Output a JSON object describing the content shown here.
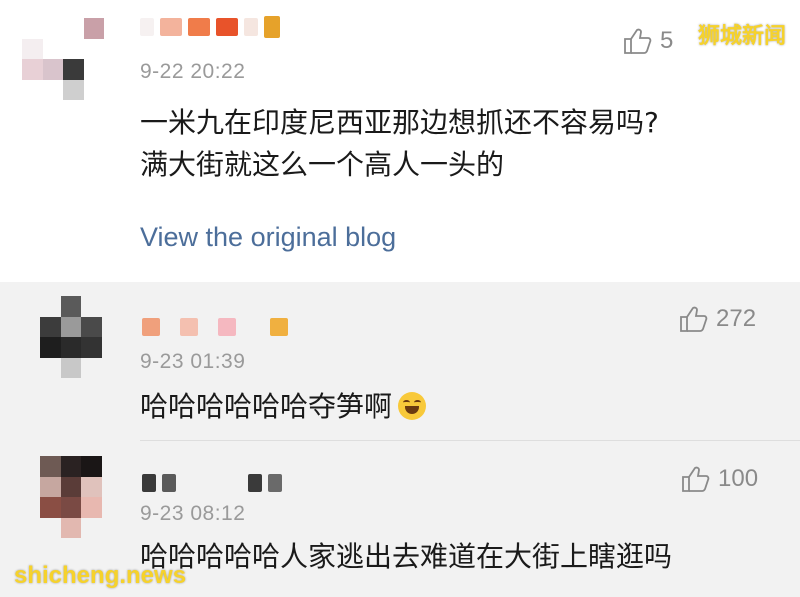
{
  "watermark_top": "狮城新闻",
  "watermark_bottom": "shicheng.news",
  "main_comment": {
    "timestamp": "9-22 20:22",
    "text_line1": "一米九在印度尼西亚那边想抓还不容易吗?",
    "text_line2": "满大街就这么一个高人一头的",
    "view_link": "View the original blog",
    "like_count": "5"
  },
  "replies": [
    {
      "timestamp": "9-23 01:39",
      "text": "哈哈哈哈哈哈夺笋啊",
      "emoji": "laughing-tears-emoji",
      "like_count": "272"
    },
    {
      "timestamp": "9-23 08:12",
      "text": "哈哈哈哈哈人家逃出去难道在大街上瞎逛吗",
      "like_count": "100"
    }
  ],
  "colors": {
    "link": "#4c6e9a",
    "timestamp": "#9a9a9a",
    "watermark": "#f6d22b",
    "reply_bg": "#f2f2f2"
  }
}
